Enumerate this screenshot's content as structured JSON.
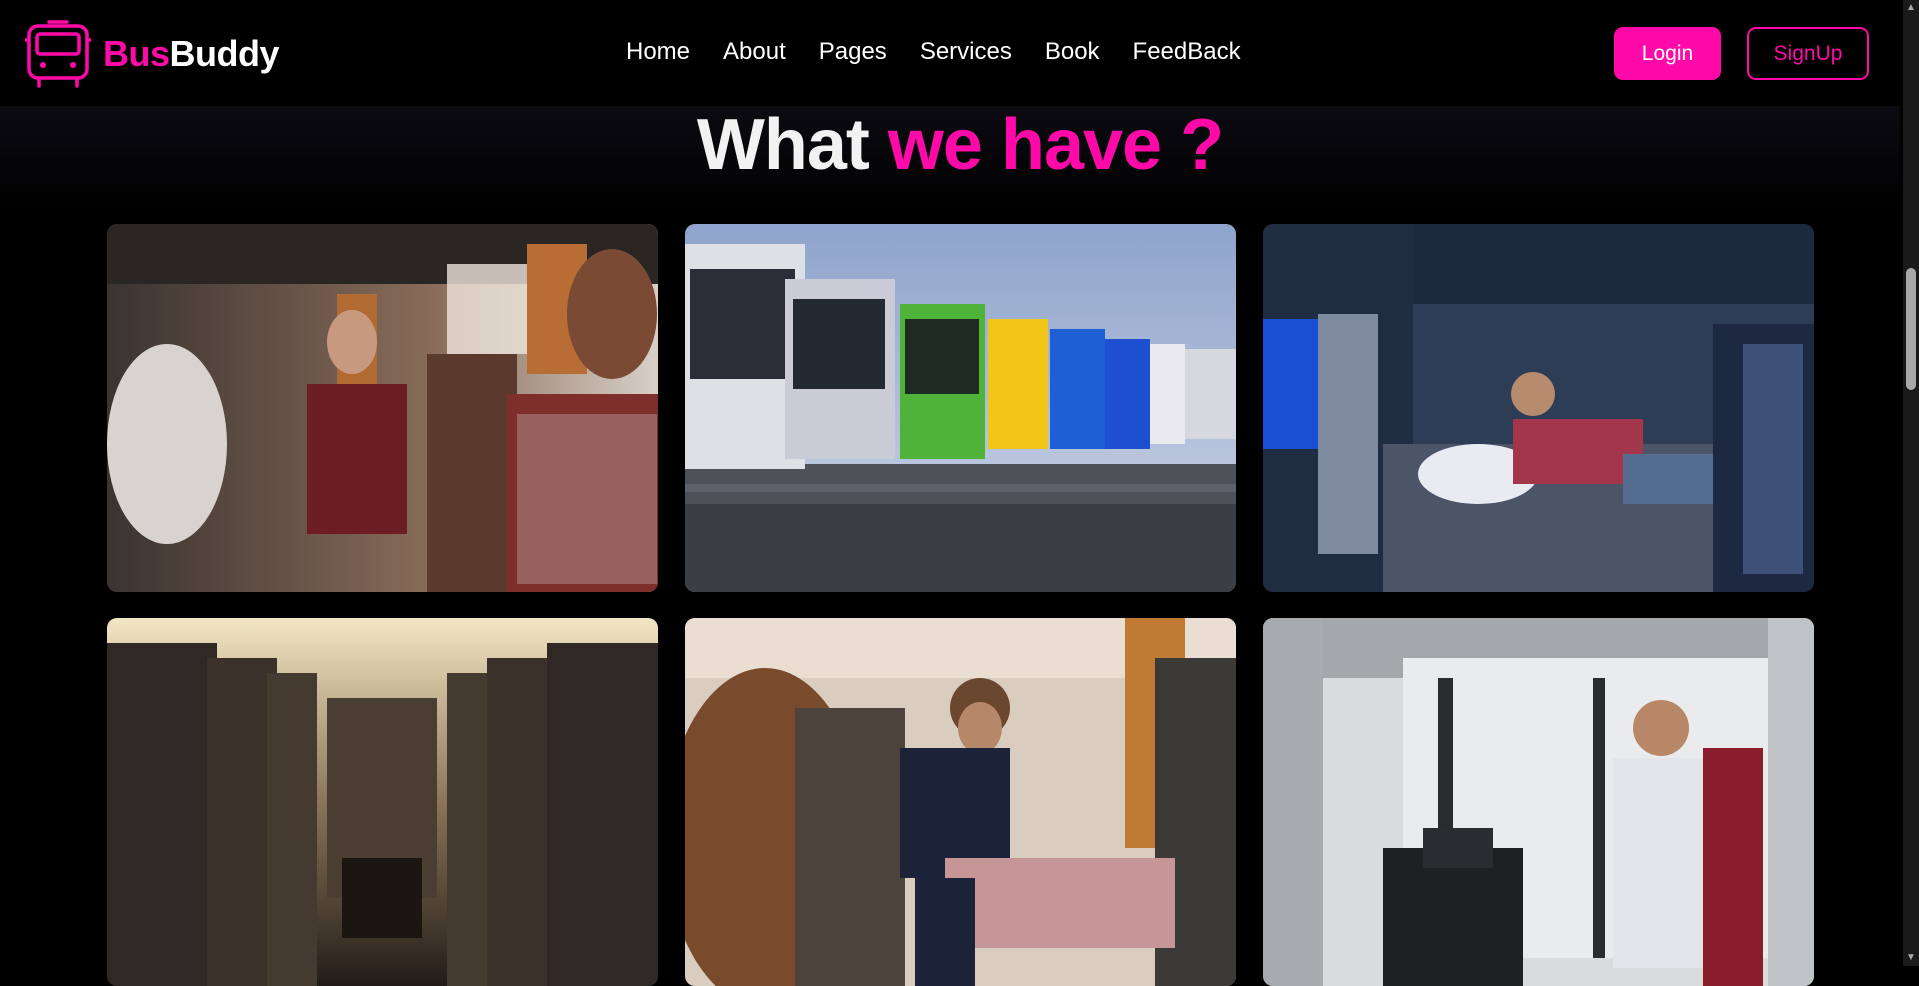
{
  "brand": {
    "part1": "Bus",
    "part2": "Buddy",
    "logo_icon": "bus-icon"
  },
  "nav": {
    "items": [
      {
        "label": "Home"
      },
      {
        "label": "About"
      },
      {
        "label": "Pages"
      },
      {
        "label": "Services"
      },
      {
        "label": "Book"
      },
      {
        "label": "FeedBack"
      }
    ]
  },
  "auth": {
    "login_label": "Login",
    "signup_label": "SignUp"
  },
  "section": {
    "heading_part1": "What",
    "heading_part2": "we have ?"
  },
  "colors": {
    "accent": "#ff0aa9",
    "background": "#000000",
    "text": "#ffffff"
  },
  "gallery": {
    "images": [
      {
        "subject": "passengers-seated-in-coach"
      },
      {
        "subject": "row-of-colorful-buses"
      },
      {
        "subject": "man-resting-in-sleeper-cabin"
      },
      {
        "subject": "empty-bus-seats-aisle"
      },
      {
        "subject": "bearded-man-with-phone-by-window"
      },
      {
        "subject": "driver-at-bus-wheel"
      }
    ]
  }
}
